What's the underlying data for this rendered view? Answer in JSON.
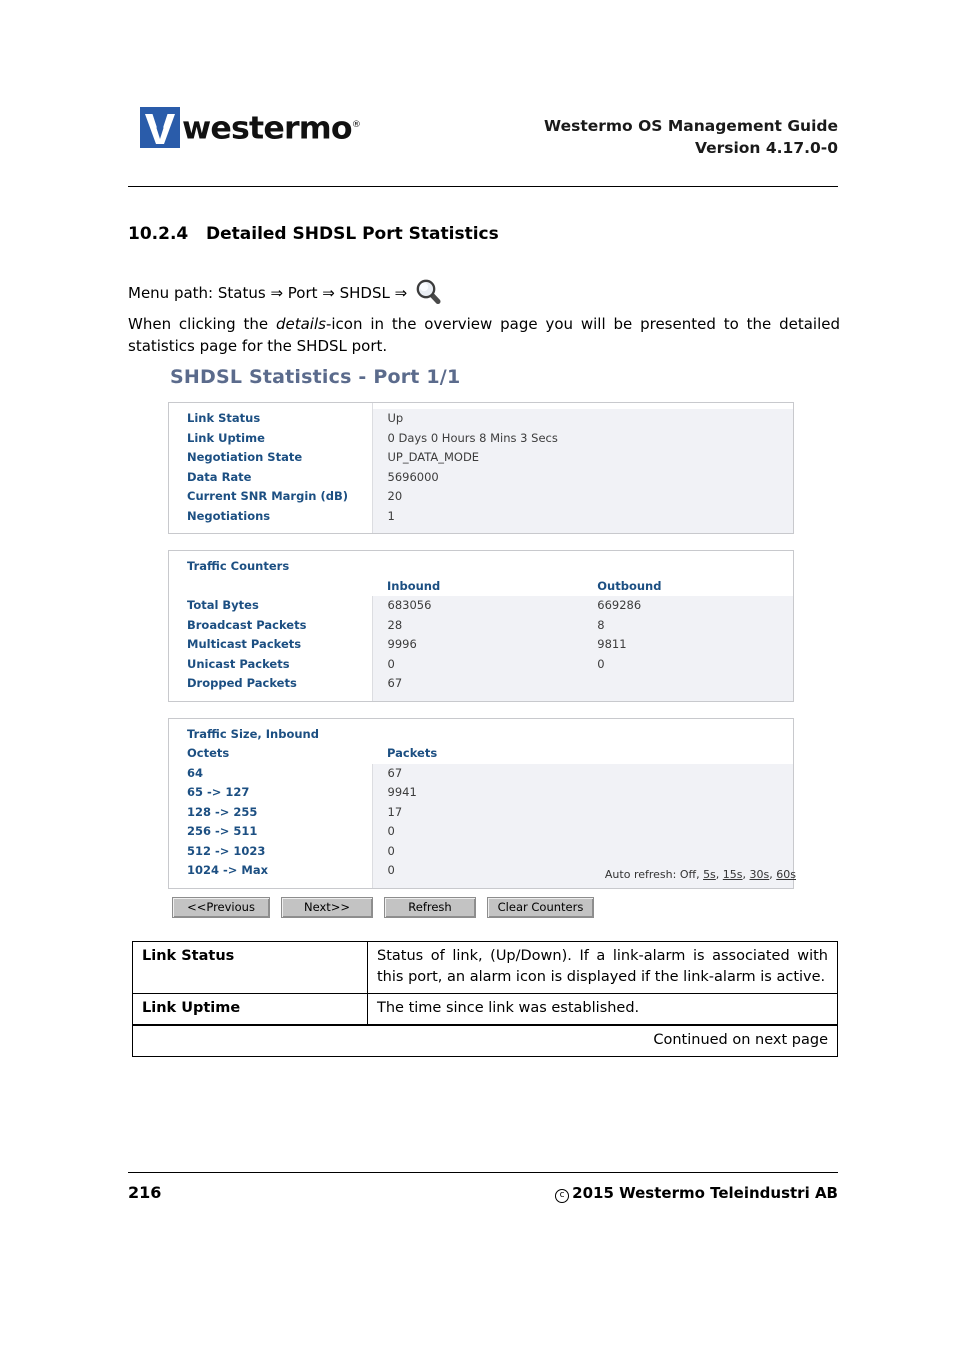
{
  "header": {
    "logo_text": "westermo",
    "logo_trademark": "®",
    "title_line1": "Westermo OS Management Guide",
    "title_line2": "Version 4.17.0-0"
  },
  "section": {
    "number": "10.2.4",
    "title": "Detailed SHDSL Port Statistics",
    "menu_path_label": "Menu path:",
    "menu_path": "Status ⇒ Port ⇒ SHDSL ⇒",
    "intro_part1": "When clicking the ",
    "intro_italic": "details",
    "intro_part2": "-icon in the overview page you will be presented to the detailed statistics page for the SHDSL port."
  },
  "screenshot": {
    "title": "SHDSL Statistics - Port 1/1",
    "link_info": {
      "rows": [
        {
          "label": "Link Status",
          "value": "Up"
        },
        {
          "label": "Link Uptime",
          "value": "0 Days 0 Hours 8 Mins 3 Secs"
        },
        {
          "label": "Negotiation State",
          "value": "UP_DATA_MODE"
        },
        {
          "label": "Data Rate",
          "value": "5696000"
        },
        {
          "label": "Current SNR Margin (dB)",
          "value": "20"
        },
        {
          "label": "Negotiations",
          "value": "1"
        }
      ]
    },
    "traffic_counters": {
      "title": "Traffic Counters",
      "col_inbound": "Inbound",
      "col_outbound": "Outbound",
      "rows": [
        {
          "label": "Total Bytes",
          "inbound": "683056",
          "outbound": "669286"
        },
        {
          "label": "Broadcast Packets",
          "inbound": "28",
          "outbound": "8"
        },
        {
          "label": "Multicast Packets",
          "inbound": "9996",
          "outbound": "9811"
        },
        {
          "label": "Unicast Packets",
          "inbound": "0",
          "outbound": "0"
        },
        {
          "label": "Dropped Packets",
          "inbound": "67",
          "outbound": ""
        }
      ]
    },
    "traffic_size": {
      "title": "Traffic Size, Inbound",
      "col_octets": "Octets",
      "col_packets": "Packets",
      "rows": [
        {
          "octets": "64",
          "packets": "67"
        },
        {
          "octets": "65 -> 127",
          "packets": "9941"
        },
        {
          "octets": "128 -> 255",
          "packets": "17"
        },
        {
          "octets": "256 -> 511",
          "packets": "0"
        },
        {
          "octets": "512 -> 1023",
          "packets": "0"
        },
        {
          "octets": "1024 -> Max",
          "packets": "0"
        }
      ]
    },
    "auto_refresh": {
      "label": "Auto refresh:",
      "off": "Off,",
      "opt5": "5s",
      "sep1": ",",
      "opt15": "15s",
      "sep2": ",",
      "opt30": "30s",
      "sep3": ",",
      "opt60": "60s"
    },
    "buttons": {
      "previous": "<<Previous",
      "next": "Next>>",
      "refresh": "Refresh",
      "clear_counters": "Clear Counters"
    }
  },
  "description_table": {
    "rows": [
      {
        "key": "Link Status",
        "value": "Status of link, (Up/Down).  If a link-alarm is associated with this port, an alarm icon is displayed if the link-alarm is active."
      },
      {
        "key": "Link Uptime",
        "value": "The time since link was established."
      }
    ],
    "continued": "Continued on next page"
  },
  "footer": {
    "page_number": "216",
    "copyright_symbol": "c",
    "copyright": "2015 Westermo Teleindustri AB"
  },
  "colors": {
    "logo_blue": "#2a5caa",
    "panel_title_blue": "#5b6b8c",
    "table_label_blue": "#1c4f82",
    "value_bg": "#f1f2f6",
    "panel_border": "#c8c9cd",
    "button_face": "#c3c3c3"
  }
}
